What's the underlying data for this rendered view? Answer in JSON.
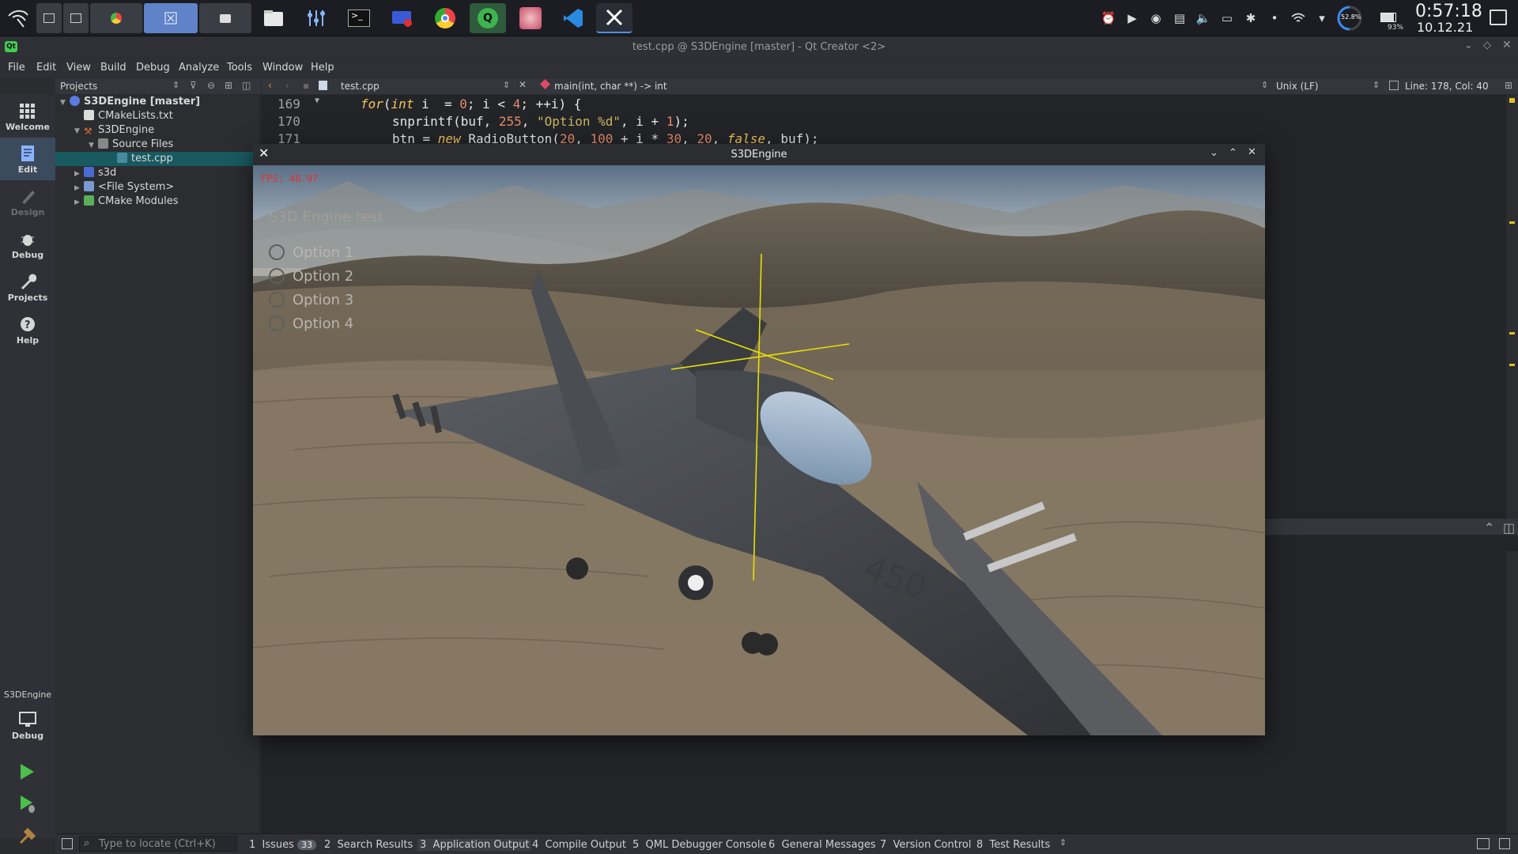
{
  "taskbar": {
    "battery_circle": "52.8%",
    "battery_level": "93%",
    "time": "0:57:18",
    "date": "10.12.21"
  },
  "window": {
    "title": "test.cpp @ S3DEngine [master] - Qt Creator <2>"
  },
  "menu": [
    "File",
    "Edit",
    "View",
    "Build",
    "Debug",
    "Analyze",
    "Tools",
    "Window",
    "Help"
  ],
  "modes": {
    "welcome": "Welcome",
    "edit": "Edit",
    "design": "Design",
    "debug": "Debug",
    "projects": "Projects",
    "help": "Help",
    "kit_name": "S3DEngine",
    "kit_mode": "Debug"
  },
  "tree": {
    "header": "Projects",
    "root": "S3DEngine [master]",
    "cmakelists": "CMakeLists.txt",
    "target": "S3DEngine",
    "source_files": "Source Files",
    "test_cpp": "test.cpp",
    "s3d": "s3d",
    "file_system": "<File System>",
    "cmake_modules": "CMake Modules"
  },
  "editor": {
    "file_tab": "test.cpp",
    "function": "main(int, char **) -> int",
    "line_ending": "Unix (LF)",
    "position": "Line: 178, Col: 40",
    "line_numbers": [
      "169",
      "170",
      "171"
    ]
  },
  "app": {
    "title": "S3DEngine",
    "fps": "FPS: 48.97",
    "heading": "S3D Engine test",
    "options": [
      "Option 1",
      "Option 2",
      "Option 3",
      "Option 4"
    ]
  },
  "status": {
    "locate_placeholder": "Type to locate (Ctrl+K)",
    "tabs": [
      {
        "num": "1",
        "label": "Issues"
      },
      {
        "num": "2",
        "label": "Search Results"
      },
      {
        "num": "3",
        "label": "Application Output"
      },
      {
        "num": "4",
        "label": "Compile Output"
      },
      {
        "num": "5",
        "label": "QML Debugger Console"
      },
      {
        "num": "6",
        "label": "General Messages"
      },
      {
        "num": "7",
        "label": "Version Control"
      },
      {
        "num": "8",
        "label": "Test Results"
      }
    ],
    "issues_count": "33"
  },
  "colors": {
    "accent_selected": "#185a60",
    "fps_red": "#e23232",
    "crosshair": "#e8e000"
  }
}
